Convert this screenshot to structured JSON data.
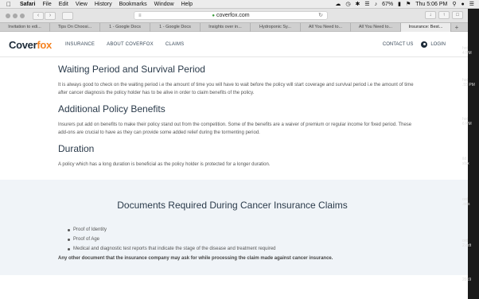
{
  "menubar": {
    "app": "Safari",
    "items": [
      "File",
      "Edit",
      "View",
      "History",
      "Bookmarks",
      "Window",
      "Help"
    ],
    "battery": "67%",
    "clock": "Thu 5:06 PM"
  },
  "browser": {
    "url": "coverfox.com",
    "tabs": [
      {
        "label": "Invitation to edi...",
        "active": false
      },
      {
        "label": "Tips On Choosi...",
        "active": false
      },
      {
        "label": "1 - Google Docs",
        "active": false
      },
      {
        "label": "1 - Google Docs",
        "active": false
      },
      {
        "label": "Insights over in...",
        "active": false
      },
      {
        "label": "Hydroponic Sy...",
        "active": false
      },
      {
        "label": "All You Need to...",
        "active": false
      },
      {
        "label": "All You Need to...",
        "active": false
      },
      {
        "label": "Insurance: Best...",
        "active": true
      }
    ],
    "new_tab": "+"
  },
  "site": {
    "logo_main": "Cover",
    "logo_accent": "fox",
    "nav": [
      "INSURANCE",
      "ABOUT COVERFOX",
      "CLAIMS"
    ],
    "contact": "CONTACT US",
    "login": "LOGIN"
  },
  "sections": [
    {
      "heading": "Waiting Period and Survival Period",
      "text": "It is always good to check on the waiting period i.e the amount of time you will have to wait before the policy will start coverage and survival period i.e the amount of time after cancer diagnosis the policy holder has to be alive in order to claim benefits of the policy."
    },
    {
      "heading": "Additional Policy Benefits",
      "text": "Insurers put add on benefits to make their policy stand out from the competition. Some of the benefits are a waiver of premium or regular income for fixed period. These add-ons are crucial to have as they can provide some added relief during the tormenting period."
    },
    {
      "heading": "Duration",
      "text": "A policy which has a long duration is beneficial as the policy holder is protected for a longer duration."
    }
  ],
  "documents": {
    "heading": "Documents Required During Cancer Insurance Claims",
    "items": [
      "Proof of Identity",
      "Proof of Age",
      "Medical and diagnostic test reports that indicate the stage of the disease and treatment required"
    ],
    "note": "Any other document that the insurance company may ask for while processing the claim made against cancer insurance."
  },
  "desktop": {
    "labels": [
      "hot",
      "4 PM",
      "hot",
      ".55 PM",
      "hot",
      "6 PM",
      "ild",
      "xlsx",
      "ord",
      ".ods",
      "ord",
      "2.odt",
      "2019"
    ]
  }
}
